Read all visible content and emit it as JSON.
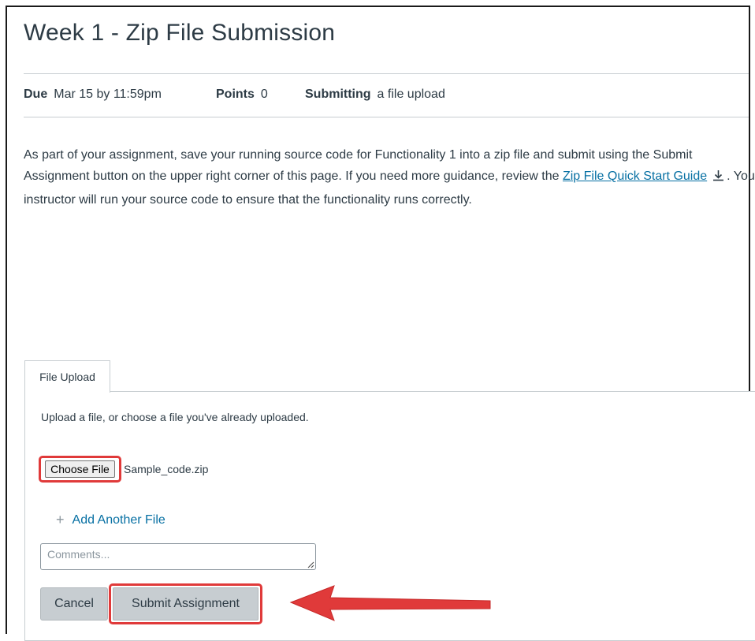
{
  "assignment": {
    "title": "Week 1 - Zip File Submission",
    "due_label": "Due",
    "due_value": "Mar 15 by 11:59pm",
    "points_label": "Points",
    "points_value": "0",
    "submitting_label": "Submitting",
    "submitting_value": "a file upload",
    "description_part1": "As part of your assignment, save your running source code for Functionality 1 into a zip file and submit using the Submit Assignment button on the upper right corner of this page. If you need more guidance, review the ",
    "guide_link_text": "Zip File Quick Start Guide",
    "description_part2": ". Your instructor will run your source code to ensure that the functionality runs correctly."
  },
  "upload": {
    "tab_label": "File Upload",
    "instructions": "Upload a file, or choose a file you've already uploaded.",
    "choose_file_label": "Choose File",
    "selected_file": "Sample_code.zip",
    "add_another_label": "Add Another File",
    "comments_placeholder": "Comments...",
    "cancel_label": "Cancel",
    "submit_label": "Submit Assignment"
  },
  "icons": {
    "download": "download-icon",
    "plus": "plus-icon",
    "annotation_arrow": "red-arrow-annotation"
  },
  "colors": {
    "link": "#0770a3",
    "highlight": "#e03a3a",
    "button_bg": "#c7cdd1",
    "text": "#2d3b45"
  }
}
